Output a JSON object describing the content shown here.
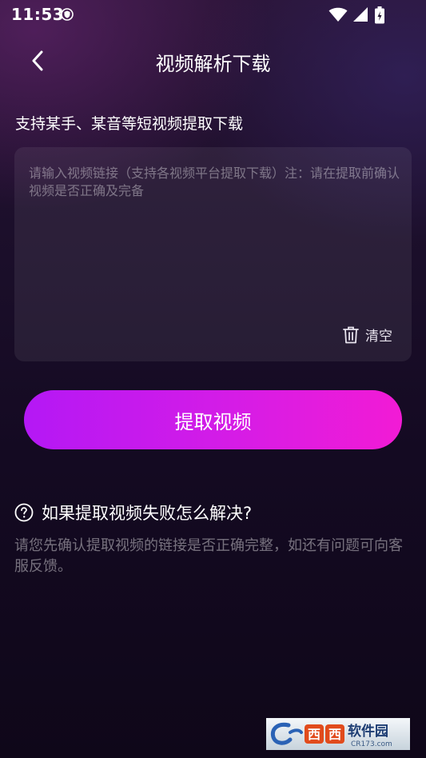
{
  "status_bar": {
    "time": "11:53"
  },
  "header": {
    "title": "视频解析下载"
  },
  "subtitle": "支持某手、某音等短视频提取下载",
  "input": {
    "value": "",
    "placeholder": "请输入视频链接（支持各视频平台提取下载）注：请在提取前确认视频是否正确及完备"
  },
  "clear_label": "清空",
  "extract_label": "提取视频",
  "faq": {
    "title": "如果提取视频失败怎么解决?",
    "body": "请您先确认提取视频的链接是否正确完整，如还有问题可向客服反馈。"
  },
  "watermark": {
    "text": "软件园",
    "sub": "CR173.com"
  },
  "colors": {
    "accent_start": "#b418f5",
    "accent_end": "#f21bd5"
  }
}
